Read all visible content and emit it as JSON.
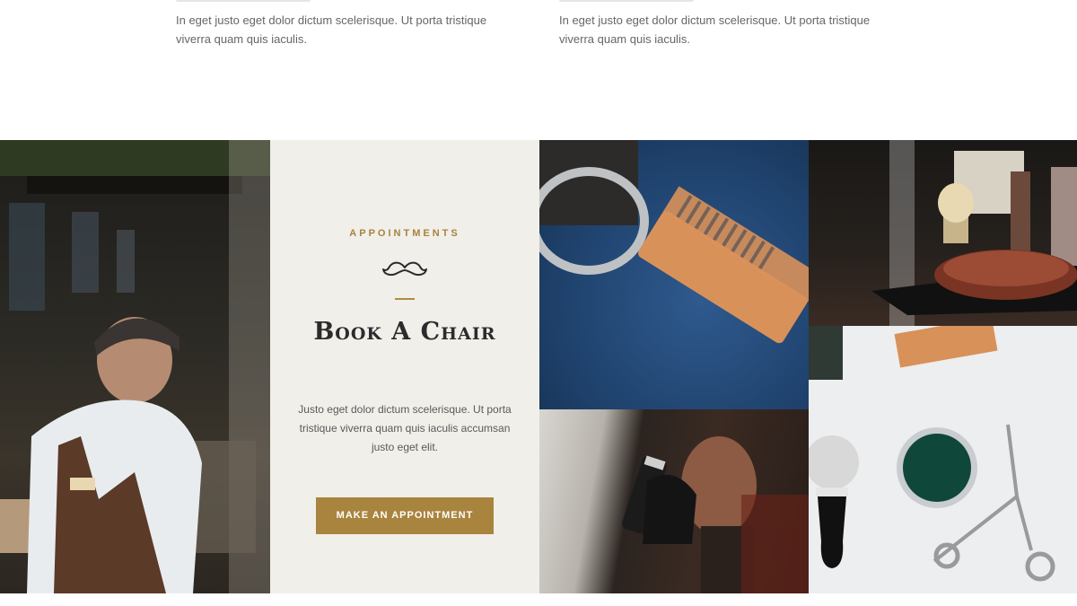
{
  "intro": {
    "col1_text": "In eget justo eget dolor dictum scelerisque. Ut porta tristique viverra quam quis iaculis.",
    "col2_text": "In eget justo eget dolor dictum scelerisque. Ut porta tristique viverra quam quis iaculis."
  },
  "appointment": {
    "eyebrow": "APPOINTMENTS",
    "title": "Book A Chair",
    "body": "Justo eget dolor dictum scelerisque. Ut porta tristique viverra quam quis iaculis accumsan justo eget elit.",
    "button_label": "MAKE AN APPOINTMENT",
    "icon": "mustache-icon"
  },
  "colors": {
    "accent": "#a8843e",
    "card_background": "#f1efea",
    "title": "#2b2b2b"
  }
}
